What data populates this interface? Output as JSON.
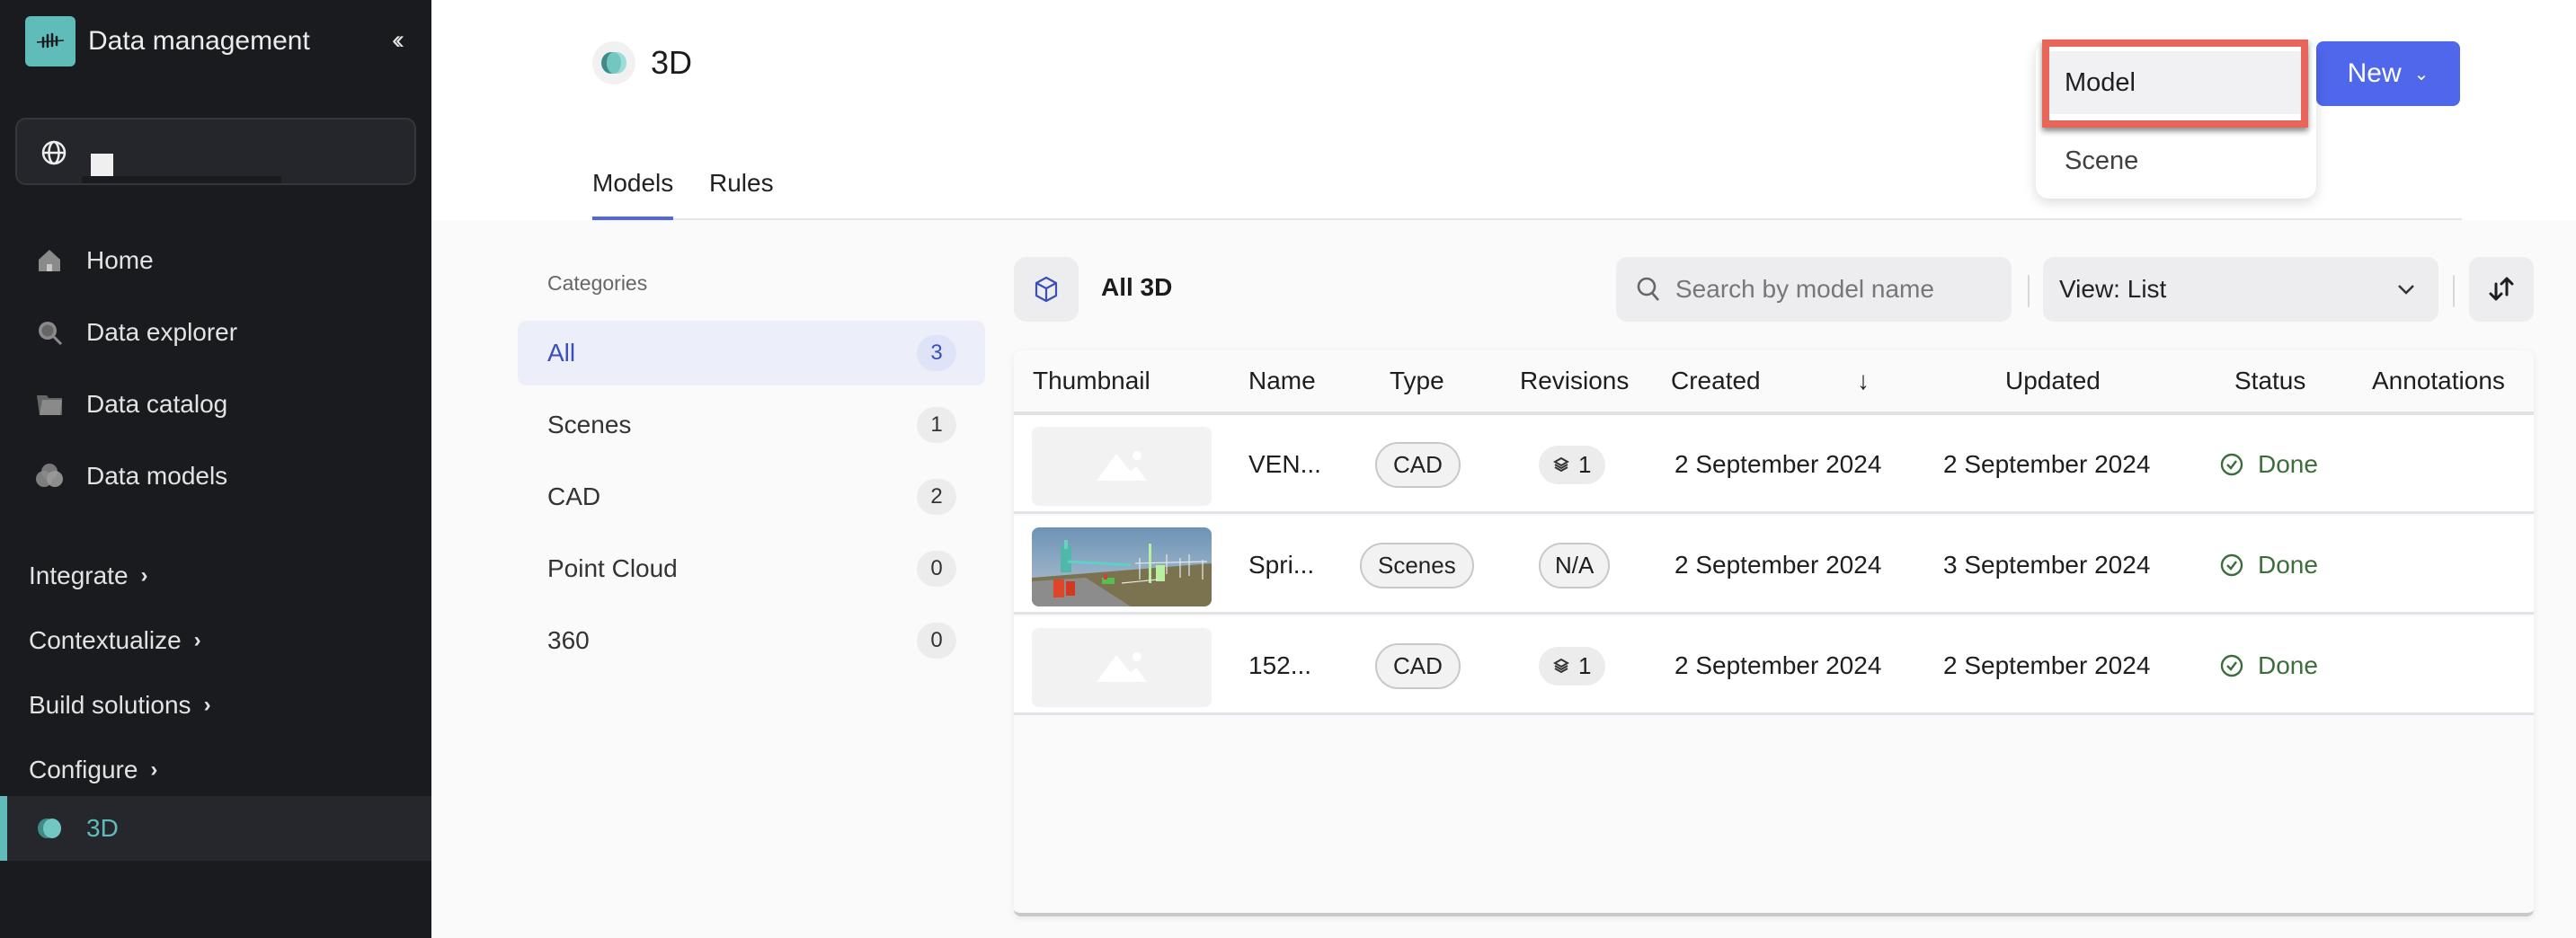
{
  "sidebar": {
    "title": "Data management",
    "collapse_icon": "double-chevron-left-icon",
    "project_icon": "globe-icon",
    "nav_items": [
      {
        "label": "Home",
        "icon": "home-icon"
      },
      {
        "label": "Data explorer",
        "icon": "search-icon"
      },
      {
        "label": "Data catalog",
        "icon": "folder-icon"
      },
      {
        "label": "Data models",
        "icon": "data-models-icon"
      }
    ],
    "groups": [
      {
        "label": "Integrate"
      },
      {
        "label": "Contextualize"
      },
      {
        "label": "Build solutions"
      },
      {
        "label": "Configure"
      }
    ],
    "active_item": {
      "label": "3D",
      "icon": "3d-icon"
    }
  },
  "header": {
    "title": "3D",
    "tabs": [
      {
        "label": "Models",
        "active": true
      },
      {
        "label": "Rules",
        "active": false
      }
    ],
    "new_button": "New"
  },
  "dropdown": {
    "items": [
      {
        "label": "Model",
        "highlighted": true
      },
      {
        "label": "Scene",
        "highlighted": false
      }
    ]
  },
  "categories": {
    "label": "Categories",
    "items": [
      {
        "name": "All",
        "count": "3",
        "active": true
      },
      {
        "name": "Scenes",
        "count": "1"
      },
      {
        "name": "CAD",
        "count": "2"
      },
      {
        "name": "Point Cloud",
        "count": "0"
      },
      {
        "name": "360",
        "count": "0"
      }
    ]
  },
  "toolbar": {
    "title": "All 3D",
    "search_placeholder": "Search by model name",
    "search_value": "",
    "view_select": "View: List"
  },
  "table": {
    "columns": [
      "Thumbnail",
      "Name",
      "Type",
      "Revisions",
      "Created",
      "Updated",
      "Status",
      "Annotations"
    ],
    "sort_indicator": "↓",
    "rows": [
      {
        "thumbnail": "placeholder",
        "name": "VEN...",
        "type": "CAD",
        "revisions": "1",
        "created": "2 September 2024",
        "updated": "2 September 2024",
        "status": "Done"
      },
      {
        "thumbnail": "scene-image",
        "name": "Spri...",
        "type": "Scenes",
        "revisions": "N/A",
        "created": "2 September 2024",
        "updated": "3 September 2024",
        "status": "Done"
      },
      {
        "thumbnail": "placeholder",
        "name": "152...",
        "type": "CAD",
        "revisions": "1",
        "created": "2 September 2024",
        "updated": "2 September 2024",
        "status": "Done"
      }
    ]
  },
  "colors": {
    "accent": "#4f67eb",
    "teal": "#5fbcb8",
    "highlight_box": "#e8655a",
    "status_done": "#3c6e3c"
  }
}
